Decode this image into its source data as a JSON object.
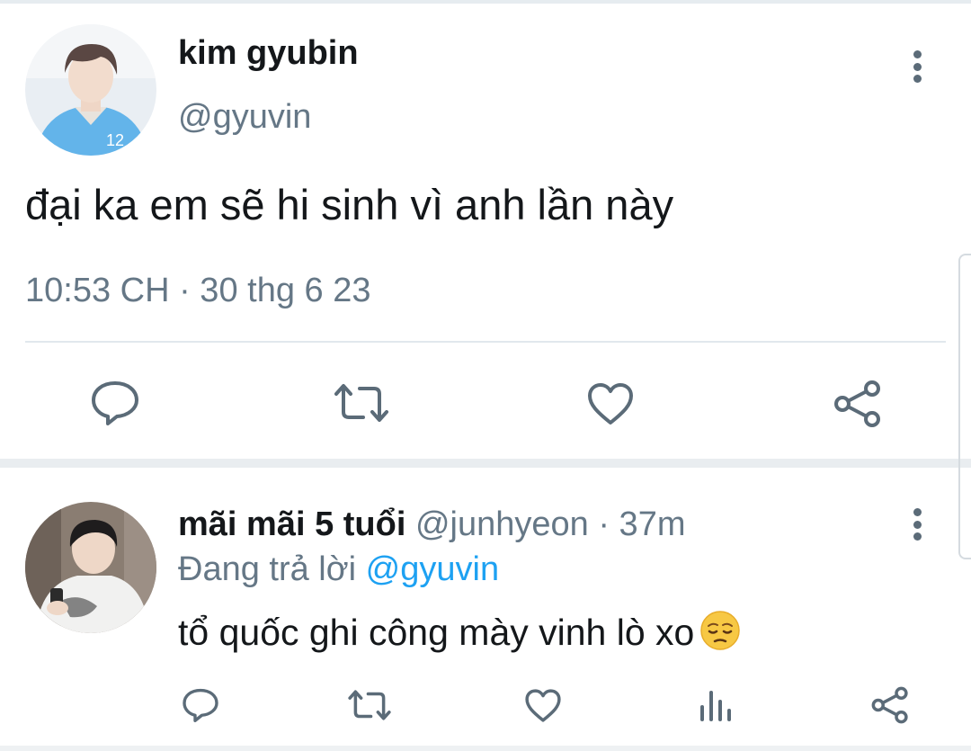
{
  "main_tweet": {
    "display_name": "kim gyubin",
    "handle": "@gyuvin",
    "text": "đại ka em sẽ hi sinh vì anh lần này",
    "timestamp": "10:53 CH · 30 thg 6 23",
    "actions": [
      "reply-icon",
      "retweet-icon",
      "like-icon",
      "share-icon"
    ]
  },
  "reply_tweet": {
    "display_name": "mãi mãi 5 tuổi",
    "handle_time": " @junhyeon · 37m",
    "replying_prefix": "Đang trả lời ",
    "replying_to": "@gyuvin",
    "text": "tổ quốc ghi công mày vinh lò xo",
    "emoji": "pensive-face-emoji",
    "actions": [
      "reply-icon",
      "retweet-icon",
      "like-icon",
      "analytics-icon",
      "share-icon"
    ]
  },
  "colors": {
    "text_primary": "#14171a",
    "text_secondary": "#657786",
    "icon": "#5b6b78",
    "mention": "#1da1f2",
    "divider": "#e1e8ed"
  }
}
